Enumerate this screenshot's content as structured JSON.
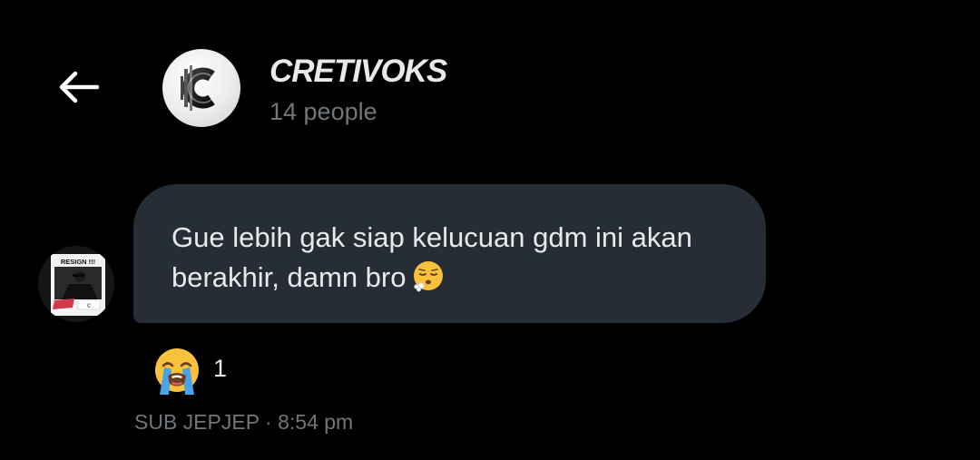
{
  "header": {
    "back_icon": "arrow-left-icon",
    "group_title": "CRETIVOKS",
    "group_member_count": "14 people",
    "group_avatar_icon": "cretivoks-logo-icon"
  },
  "message": {
    "text": "Gue lebih gak siap kelucuan gdm ini akan berakhir, damn bro",
    "emoji_icon": "face-exhaling-emoji",
    "sender_avatar_icon": "sender-avatar",
    "sender_avatar_sticker_text": "RESIGN !!!",
    "sender_name": "SUB JEPJEP",
    "separator": "·",
    "time": "8:54 pm",
    "bubble_color": "#262d34"
  },
  "reaction": {
    "emoji_icon": "loudly-crying-face-emoji",
    "count": "1"
  },
  "colors": {
    "background": "#000000",
    "text_primary": "#e7e9ea",
    "text_secondary": "#71767b"
  }
}
